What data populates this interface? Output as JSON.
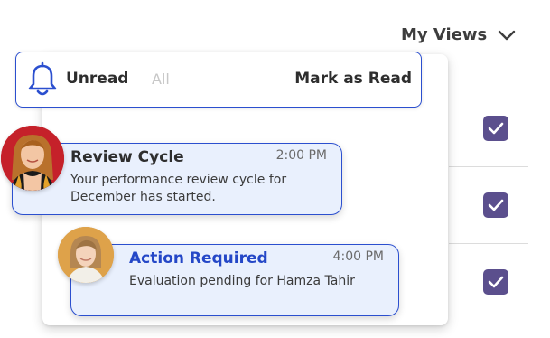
{
  "views": {
    "label": "My Views"
  },
  "header": {
    "unread_label": "Unread",
    "all_label": "All",
    "mark_read_label": "Mark as Read"
  },
  "notifications": [
    {
      "title": "Review Cycle",
      "time": "2:00 PM",
      "body_line1": "Your performance review cycle for",
      "body_line2": "December has started.",
      "title_color": "#2e2e2e"
    },
    {
      "title": "Action Required",
      "time": "4:00 PM",
      "body_line1": "Evaluation pending for Hamza Tahir",
      "title_color": "#2447c7"
    }
  ],
  "colors": {
    "accent": "#2b4fcf",
    "checkbox": "#5b4f8d",
    "card_bg": "#e9f0fd"
  },
  "icons": [
    "chevron-down-icon",
    "bell-icon",
    "check-icon"
  ]
}
